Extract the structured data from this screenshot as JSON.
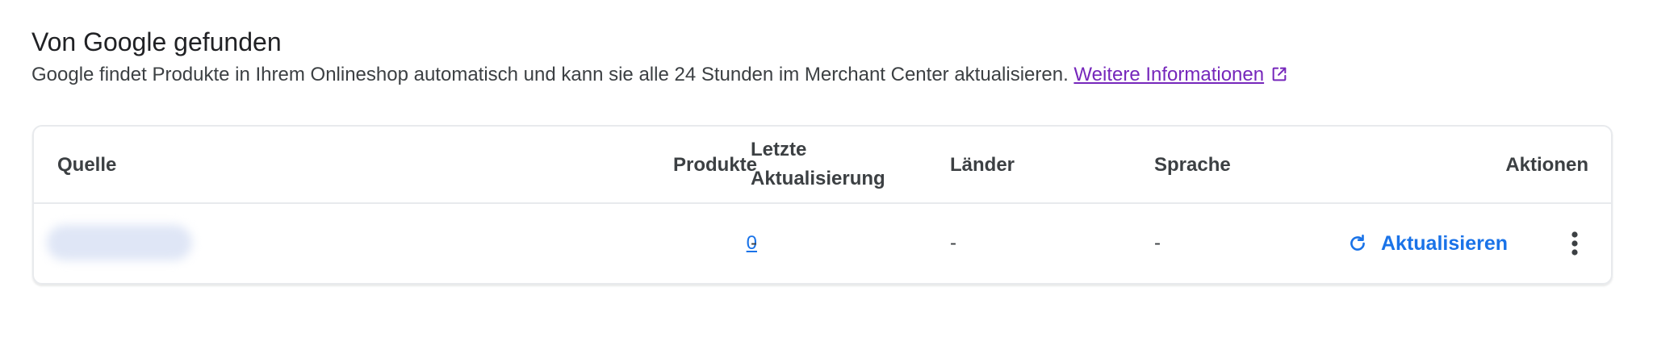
{
  "section": {
    "title": "Von Google gefunden",
    "description": "Google findet Produkte in Ihrem Onlineshop automatisch und kann sie alle 24 Stunden im Merchant Center aktualisieren.",
    "learn_more_label": "Weitere Informationen",
    "learn_more_icon": "open-in-new-icon"
  },
  "table": {
    "headers": {
      "source": "Quelle",
      "products": "Produkte",
      "last_update": "Letzte Aktualisierung",
      "countries": "Länder",
      "language": "Sprache",
      "actions": "Aktionen"
    },
    "rows": [
      {
        "products": "0",
        "last_update": "-",
        "countries": "-",
        "language": "-",
        "refresh_label": "Aktualisieren",
        "refresh_icon": "refresh-icon",
        "more_icon": "more-vert-icon"
      }
    ]
  },
  "colors": {
    "link": "#7627bb",
    "accent": "#1a73e8",
    "text": "#3c4043",
    "border": "#e8eaed"
  }
}
